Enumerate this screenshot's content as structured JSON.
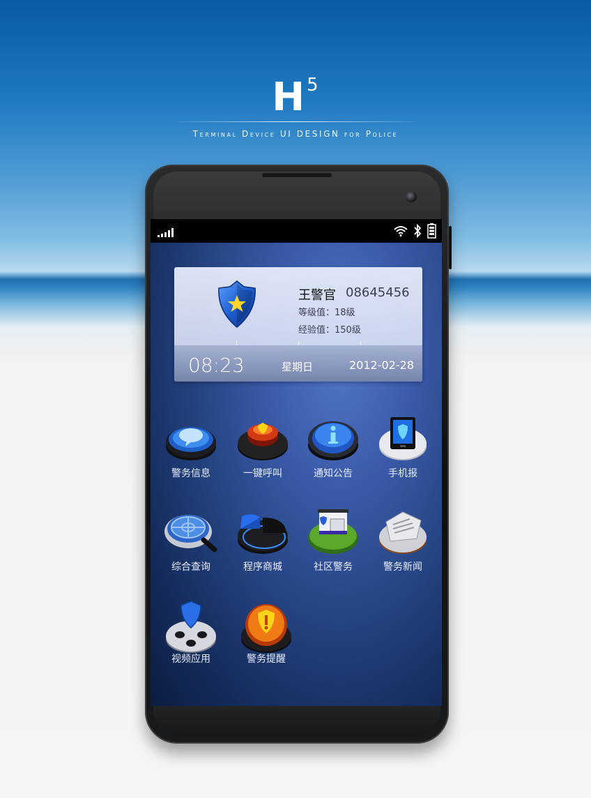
{
  "brand": {
    "logo": "H",
    "logo_sup": "5",
    "subtitle": "Terminal Device UI DESIGN for Police"
  },
  "colors": {
    "screen_bg": "#24427f",
    "card_bg": "#dfe6f7",
    "accent_blue": "#2f6fe0"
  },
  "status": {
    "signal_icon": "signal-icon",
    "wifi_icon": "wifi-icon",
    "bluetooth_icon": "bluetooth-icon",
    "battery_icon": "battery-icon"
  },
  "profile": {
    "name": "王警官",
    "number": "08645456",
    "level": "等级值：18级",
    "experience": "经验值：150级",
    "time": "08:23",
    "weekday": "星期日",
    "date": "2012-02-28"
  },
  "apps": [
    {
      "label": "警务信息",
      "icon": "chat-bubble-icon"
    },
    {
      "label": "一键呼叫",
      "icon": "alarm-button-icon"
    },
    {
      "label": "通知公告",
      "icon": "info-icon"
    },
    {
      "label": "手机报",
      "icon": "phone-shield-icon"
    },
    {
      "label": "综合查询",
      "icon": "magnifier-icon"
    },
    {
      "label": "程序商城",
      "icon": "pie-store-icon"
    },
    {
      "label": "社区警务",
      "icon": "police-station-icon"
    },
    {
      "label": "警务新闻",
      "icon": "newspaper-icon"
    },
    {
      "label": "视频应用",
      "icon": "film-reel-icon"
    },
    {
      "label": "警务提醒",
      "icon": "warning-icon"
    }
  ]
}
